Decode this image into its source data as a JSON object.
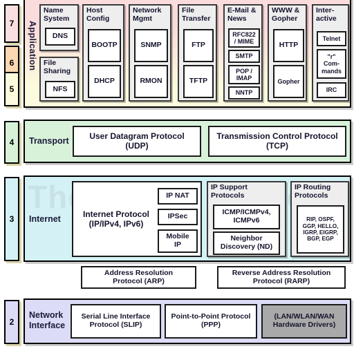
{
  "diagram": {
    "watermark": "The TCP/IP Guide",
    "layers": [
      {
        "numbers": [
          "7",
          "6",
          "5"
        ],
        "name": "Application",
        "orientation": "vertical",
        "fill_top": "#fbdcdc",
        "fill_bottom": "#fdfbdd",
        "number_fills": [
          "#fadfe1",
          "#fbd7b2",
          "#fdfbdd"
        ]
      },
      {
        "numbers": [
          "4"
        ],
        "name": "Transport",
        "orientation": "horizontal",
        "fill": "#d8f2da",
        "number_fills": [
          "#d8f2da"
        ]
      },
      {
        "numbers": [
          "3"
        ],
        "name": "Internet",
        "orientation": "horizontal",
        "fill": "#d4f2f5",
        "number_fills": [
          "#d4f2f5"
        ]
      },
      {
        "numbers": [
          "2"
        ],
        "name": "Network\nInterface",
        "orientation": "horizontal",
        "fill": "#dcdcf7",
        "number_fills": [
          "#dcdcf7"
        ]
      }
    ],
    "application": {
      "groups": [
        {
          "title": "Name\nSystem",
          "items": [
            "DNS"
          ]
        },
        {
          "title": "File\nSharing",
          "items": [
            "NFS"
          ]
        },
        {
          "title": "Host\nConfig",
          "items": [
            "BOOTP",
            "DHCP"
          ]
        },
        {
          "title": "Network\nMgmt",
          "items": [
            "SNMP",
            "RMON"
          ]
        },
        {
          "title": "File\nTransfer",
          "items": [
            "FTP",
            "TFTP"
          ]
        },
        {
          "title": "E-Mail &\nNews",
          "items": [
            "RFC822\n/ MIME",
            "SMTP",
            "POP /\nIMAP",
            "NNTP"
          ]
        },
        {
          "title": "WWW &\nGopher",
          "items": [
            "HTTP",
            "Gopher"
          ]
        },
        {
          "title": "Inter-\nactive",
          "items": [
            "Telnet",
            "\"r\"\nCom-\nmands",
            "IRC"
          ]
        }
      ]
    },
    "transport": {
      "items": [
        "User Datagram Protocol\n(UDP)",
        "Transmission Control Protocol\n(TCP)"
      ]
    },
    "internet": {
      "ip_box": "Internet Protocol\n(IP/IPv4, IPv6)",
      "ip_side_items": [
        "IP NAT",
        "IPSec",
        "Mobile\nIP"
      ],
      "groups": [
        {
          "title": "IP Support\nProtocols",
          "items": [
            "ICMP/ICMPv4,\nICMPv6",
            "Neighbor\nDiscovery (ND)"
          ]
        },
        {
          "title": "IP Routing\nProtocols",
          "items": [
            "RIP, OSPF,\nGGP, HELLO,\nIGRP, EIGRP,\nBGP, EGP"
          ]
        }
      ]
    },
    "bridge": {
      "items": [
        "Address Resolution\nProtocol (ARP)",
        "Reverse Address Resolution\nProtocol (RARP)"
      ]
    },
    "network_interface": {
      "items": [
        {
          "label": "Serial Line Interface\nProtocol (SLIP)",
          "grey": false
        },
        {
          "label": "Point-to-Point Protocol\n(PPP)",
          "grey": false
        },
        {
          "label": "(LAN/WLAN/WAN\nHardware Drivers)",
          "grey": true
        }
      ]
    }
  }
}
